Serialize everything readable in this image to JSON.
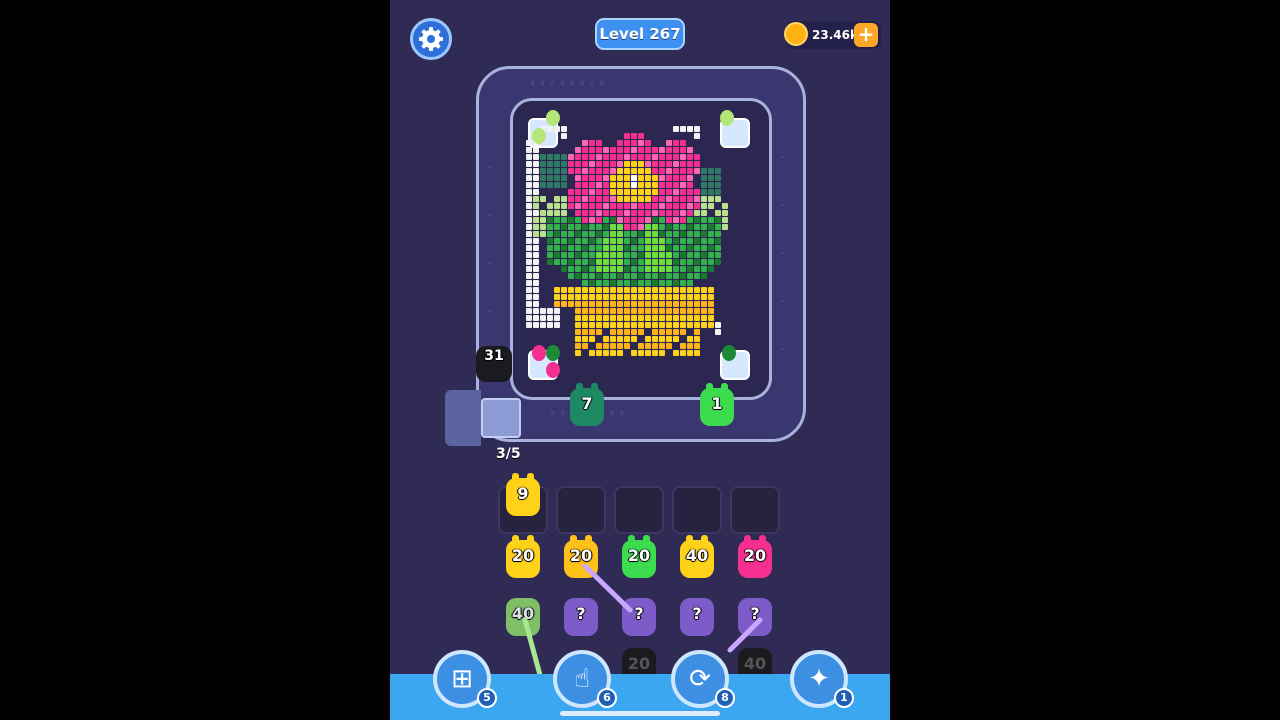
{
  "hud": {
    "level_label": "Level 267",
    "coins": "23.46k",
    "add_coins_label": "+",
    "settings_icon": "gear-icon",
    "coin_icon": "coin-icon"
  },
  "board": {
    "picture": "flower-in-pot",
    "cannon_count": "31",
    "launcher_queue": "3/5",
    "track_pigs": [
      {
        "value": "7",
        "color": "#1d8a63"
      },
      {
        "value": "1",
        "color": "#3ddc4f"
      }
    ]
  },
  "waiting_slots": [
    {
      "value": "9",
      "color": "#ffd21a"
    },
    {
      "value": "",
      "color": ""
    },
    {
      "value": "",
      "color": ""
    },
    {
      "value": "",
      "color": ""
    },
    {
      "value": "",
      "color": ""
    }
  ],
  "pig_columns": [
    {
      "front": {
        "value": "20",
        "color": "#ffd21a"
      },
      "behind": {
        "value": "40",
        "color": "#8fd96a"
      }
    },
    {
      "front": {
        "value": "20",
        "color": "#ffc21a"
      },
      "behind": {
        "value": "?",
        "color": "#7d5cc9"
      }
    },
    {
      "front": {
        "value": "20",
        "color": "#3ddc4f"
      },
      "behind": {
        "value": "?",
        "color": "#7d5cc9"
      }
    },
    {
      "front": {
        "value": "40",
        "color": "#ffd21a"
      },
      "behind": {
        "value": "?",
        "color": "#7d5cc9"
      }
    },
    {
      "front": {
        "value": "20",
        "color": "#f52f8f"
      },
      "behind": {
        "value": "?",
        "color": "#7d5cc9"
      }
    }
  ],
  "hidden_row": [
    "20",
    "40"
  ],
  "powerups": [
    {
      "icon": "add-slot-icon",
      "count": "5"
    },
    {
      "icon": "hand-tap-icon",
      "count": "6"
    },
    {
      "icon": "shuffle-icon",
      "count": "8"
    },
    {
      "icon": "magic-pig-icon",
      "count": "1"
    }
  ],
  "colors": {
    "background": "#2f2b55",
    "track": "#a8b2dc",
    "pink": "#f52f8f",
    "yellow": "#ffd21a",
    "green": "#3ddc4f",
    "dark_green": "#1d8a63",
    "accent_blue": "#3c8fe3"
  }
}
